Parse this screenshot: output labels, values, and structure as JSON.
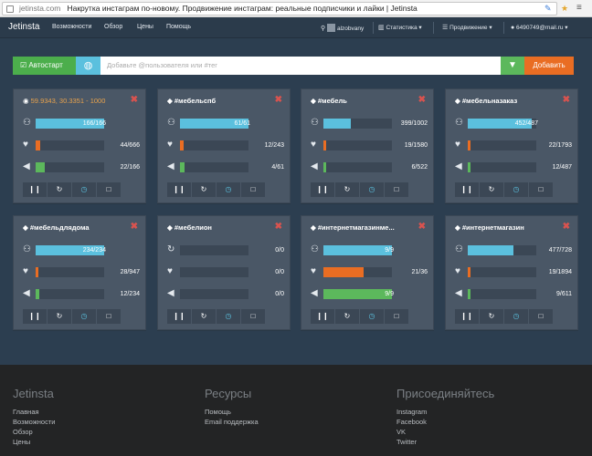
{
  "browser": {
    "host": "jetinsta.com",
    "title": "Накрутка инстаграм по-новому. Продвижение инстаграм: реальные подписчики и лайки | Jetinsta"
  },
  "nav": {
    "brand": "Jetinsta",
    "links": [
      "Возможности",
      "Обзор",
      "Цены",
      "Помощь"
    ],
    "user": "alzobvany",
    "stats": "Статистика",
    "promo": "Продвижение",
    "email": "6490749@mail.ru"
  },
  "toolbar": {
    "autostart": "Автостарт",
    "search_placeholder": "Добавьте @пользователя или #тег",
    "add": "Добавить"
  },
  "cards": [
    {
      "title": "59.9343, 30.3351 - 1000",
      "type": "location",
      "followers": {
        "text": "166/166",
        "fraction": 1.0,
        "color": "blue",
        "inside": true
      },
      "likes": {
        "text": "44/666",
        "fraction": 0.07,
        "color": "orange"
      },
      "ads": {
        "text": "22/166",
        "fraction": 0.13,
        "color": "green"
      }
    },
    {
      "title": "#мебельспб",
      "type": "tag",
      "followers": {
        "text": "61/61",
        "fraction": 1.0,
        "color": "blue",
        "inside": true
      },
      "likes": {
        "text": "12/243",
        "fraction": 0.05,
        "color": "orange"
      },
      "ads": {
        "text": "4/61",
        "fraction": 0.07,
        "color": "green"
      }
    },
    {
      "title": "#мебель",
      "type": "tag",
      "followers": {
        "text": "399/1002",
        "fraction": 0.4,
        "color": "blue"
      },
      "likes": {
        "text": "19/1580",
        "fraction": 0.015,
        "color": "orange"
      },
      "ads": {
        "text": "6/522",
        "fraction": 0.015,
        "color": "green"
      }
    },
    {
      "title": "#мебельназаказ",
      "type": "tag",
      "followers": {
        "text": "452/487",
        "fraction": 0.93,
        "color": "blue",
        "inside": true
      },
      "likes": {
        "text": "22/1793",
        "fraction": 0.015,
        "color": "orange"
      },
      "ads": {
        "text": "12/487",
        "fraction": 0.03,
        "color": "green"
      }
    },
    {
      "title": "#мебельдлядома",
      "type": "tag",
      "followers": {
        "text": "234/234",
        "fraction": 1.0,
        "color": "blue",
        "inside": true
      },
      "likes": {
        "text": "28/947",
        "fraction": 0.03,
        "color": "orange"
      },
      "ads": {
        "text": "12/234",
        "fraction": 0.05,
        "color": "green"
      }
    },
    {
      "title": "#мебелион",
      "type": "tag",
      "followers": {
        "text": "0/0",
        "fraction": 0,
        "color": "blue"
      },
      "likes": {
        "text": "0/0",
        "fraction": 0,
        "color": "orange"
      },
      "ads": {
        "text": "0/0",
        "fraction": 0,
        "color": "green"
      },
      "followers_icon": "refresh-icon"
    },
    {
      "title": "#интернетмагазинме...",
      "type": "tag",
      "followers": {
        "text": "9/9",
        "fraction": 1.0,
        "color": "blue",
        "inside": true
      },
      "likes": {
        "text": "21/36",
        "fraction": 0.58,
        "color": "orange"
      },
      "ads": {
        "text": "9/9",
        "fraction": 1.0,
        "color": "green",
        "inside": true
      }
    },
    {
      "title": "#интернетмагазин",
      "type": "tag",
      "followers": {
        "text": "477/728",
        "fraction": 0.66,
        "color": "blue"
      },
      "likes": {
        "text": "19/1894",
        "fraction": 0.01,
        "color": "orange"
      },
      "ads": {
        "text": "9/611",
        "fraction": 0.015,
        "color": "green"
      }
    }
  ],
  "footer": {
    "brand": "Jetinsta",
    "col1": [
      "Главная",
      "Возможности",
      "Обзор",
      "Цены"
    ],
    "resources_title": "Ресурсы",
    "col2": [
      "Помощь",
      "Email поддержка"
    ],
    "join_title": "Присоединяйтесь",
    "col3": [
      "Instagram",
      "Facebook",
      "VK",
      "Twitter"
    ]
  },
  "colors": {
    "blue": "#5bc0de",
    "orange": "#e96d23",
    "green": "#5cb85c",
    "card_bg": "#4a5766",
    "page_bg": "#2c3e50"
  }
}
